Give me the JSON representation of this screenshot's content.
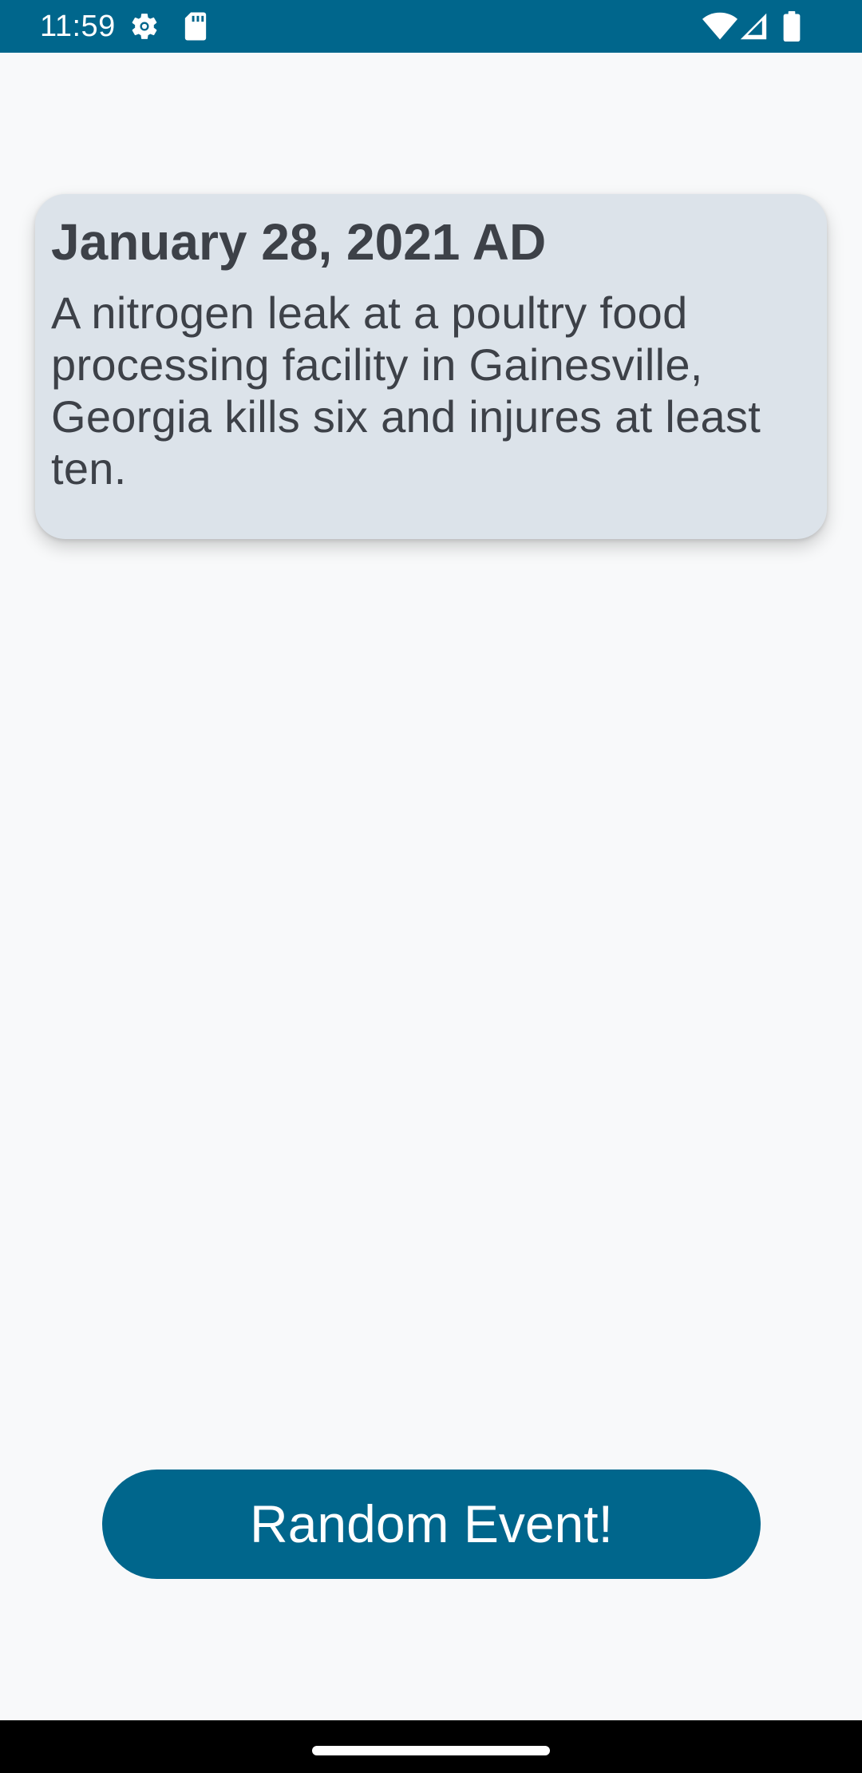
{
  "status_bar": {
    "time": "11:59",
    "background": "#00668c",
    "icons": [
      "gear-icon",
      "sd-card-icon",
      "wifi-icon",
      "signal-icon",
      "battery-icon"
    ]
  },
  "event": {
    "date": "January 28, 2021 AD",
    "description": "A nitrogen leak at a poultry food processing facility in Gainesville, Georgia kills six and injures at least ten."
  },
  "actions": {
    "random_label": "Random Event!",
    "accent": "#00668c"
  },
  "nav_bar": {
    "handle": "home-handle"
  }
}
